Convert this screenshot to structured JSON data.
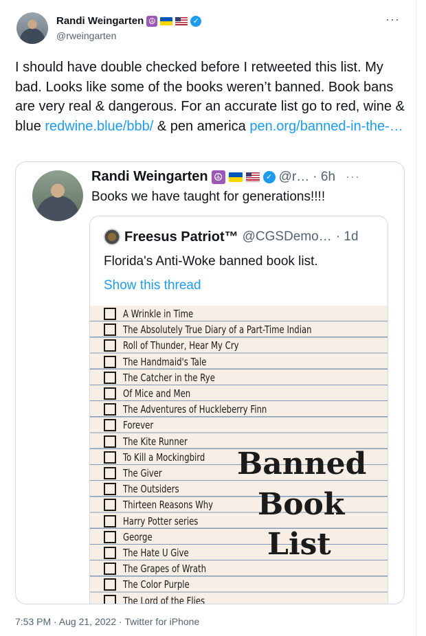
{
  "tweet": {
    "author_name": "Randi Weingarten",
    "handle": "@rweingarten",
    "more_glyph": "···",
    "text_1": "I should have double checked before I retweeted this list. My bad. Looks like some of the books weren’t banned. Book bans are very real & dangerous. For an accurate list go to red, wine & blue ",
    "link_1": "redwine.blue/bbb/",
    "text_2": " & pen america ",
    "link_2": "pen.org/banned-in-the-…",
    "timestamp": "7:53 PM · Aug 21, 2022",
    "source": "Twitter for iPhone"
  },
  "quote": {
    "author_name": "Randi Weingarten",
    "handle": "@r…",
    "time": "· 6h",
    "more_glyph": "···",
    "text": "Books we have taught for generations!!!!"
  },
  "inner_quote": {
    "author_name": "Freesus Patriot™",
    "handle": "@CGSDemo…",
    "time": "· 1d",
    "text": "Florida's Anti-Woke banned book list.",
    "show_thread": "Show this thread",
    "books": [
      "A Wrinkle in Time",
      "The Absolutely True Diary of a Part-Time Indian",
      "Roll of Thunder, Hear My Cry",
      "The Handmaid's Tale",
      "The Catcher in the Rye",
      "Of Mice and Men",
      "The Adventures of Huckleberry Finn",
      "Forever",
      "The Kite Runner",
      "To Kill a Mockingbird",
      "The Giver",
      "The Outsiders",
      "Thirteen Reasons Why",
      "Harry Potter series",
      "George",
      "The Hate U Give",
      "The Grapes of Wrath",
      "The Color Purple",
      "The Lord of the Flies"
    ],
    "big_words": [
      "Banned",
      "Book",
      "List"
    ]
  },
  "icons": {
    "peace": "☮",
    "verified": "✓"
  },
  "colors": {
    "link": "#1d9bf0",
    "secondary_text": "#536471",
    "paper": "#f7efe6"
  }
}
